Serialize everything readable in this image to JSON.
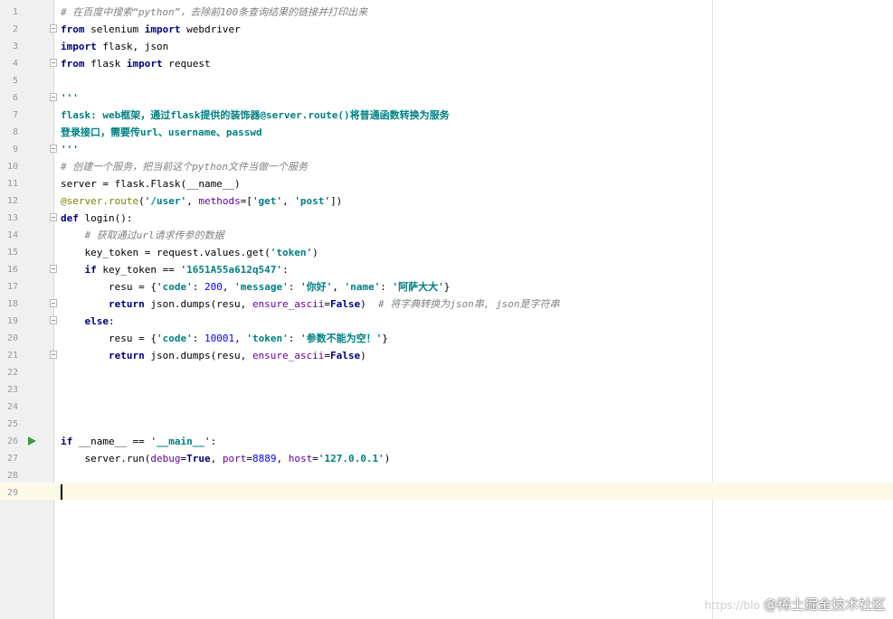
{
  "editor": {
    "line_numbers": [
      "1",
      "2",
      "3",
      "4",
      "5",
      "6",
      "7",
      "8",
      "9",
      "10",
      "11",
      "12",
      "13",
      "14",
      "15",
      "16",
      "17",
      "18",
      "19",
      "20",
      "21",
      "22",
      "23",
      "24",
      "25",
      "26",
      "27",
      "28",
      "29"
    ],
    "lines": {
      "l1": "# 在百度中搜索“python”，去除前100条查询结果的链接并打印出来",
      "l2a": "from",
      "l2b": " selenium ",
      "l2c": "import",
      "l2d": " webdriver",
      "l3a": "import",
      "l3b": " flask, json",
      "l4a": "from",
      "l4b": " flask ",
      "l4c": "import",
      "l4d": " request",
      "l6": "'''",
      "l7": "flask: web框架，通过flask提供的装饰器@server.route()将普通函数转换为服务",
      "l8": "登录接口，需要传url、username、passwd",
      "l9": "'''",
      "l10": "# 创建一个服务，把当前这个python文件当做一个服务",
      "l11": "server = flask.Flask(__name__)",
      "l12a": "@server.route",
      "l12b": "(",
      "l12c": "'/user'",
      "l12d": ", ",
      "l12e": "methods",
      "l12f": "=[",
      "l12g": "'get'",
      "l12h": ", ",
      "l12i": "'post'",
      "l12j": "])",
      "l13a": "def",
      "l13b": " login():",
      "l14": "    # 获取通过url请求传参的数据",
      "l15a": "    key_token = request.values.get(",
      "l15b": "'token'",
      "l15c": ")",
      "l16a": "    if",
      "l16b": " key_token == ",
      "l16c": "'1651A55a612q547'",
      "l16d": ":",
      "l17a": "        resu = {",
      "l17b": "'code'",
      "l17c": ": ",
      "l17d": "200",
      "l17e": ", ",
      "l17f": "'message'",
      "l17g": ": ",
      "l17h": "'你好'",
      "l17i": ", ",
      "l17j": "'name'",
      "l17k": ": ",
      "l17l": "'阿萨大大'",
      "l17m": "}",
      "l18a": "        return",
      "l18b": " json.dumps(resu, ",
      "l18c": "ensure_ascii",
      "l18d": "=",
      "l18e": "False",
      "l18f": ")  ",
      "l18g": "# 将字典转换为json串, json是字符串",
      "l19a": "    else",
      "l19b": ":",
      "l20a": "        resu = {",
      "l20b": "'code'",
      "l20c": ": ",
      "l20d": "10001",
      "l20e": ", ",
      "l20f": "'token'",
      "l20g": ": ",
      "l20h": "'参数不能为空！'",
      "l20i": "}",
      "l21a": "        return",
      "l21b": " json.dumps(resu, ",
      "l21c": "ensure_ascii",
      "l21d": "=",
      "l21e": "False",
      "l21f": ")",
      "l26a": "if",
      "l26b": " __name__ == ",
      "l26c": "'__main__'",
      "l26d": ":",
      "l27a": "    server.run(",
      "l27b": "debug",
      "l27c": "=",
      "l27d": "True",
      "l27e": ", ",
      "l27f": "port",
      "l27g": "=",
      "l27h": "8889",
      "l27i": ", ",
      "l27j": "host",
      "l27k": "=",
      "l27l": "'127.0.0.1'",
      "l27m": ")"
    }
  },
  "watermark": {
    "url": "https://blo",
    "text": "@稀土掘金技术社区"
  },
  "colors": {
    "keyword": "#000080",
    "string": "#008080",
    "comment": "#808080",
    "current_line": "#fcf9e6",
    "run_icon": "#3d9a3d"
  },
  "icons": {
    "run": "run-arrow-icon",
    "fold": "fold-marker-icon"
  }
}
